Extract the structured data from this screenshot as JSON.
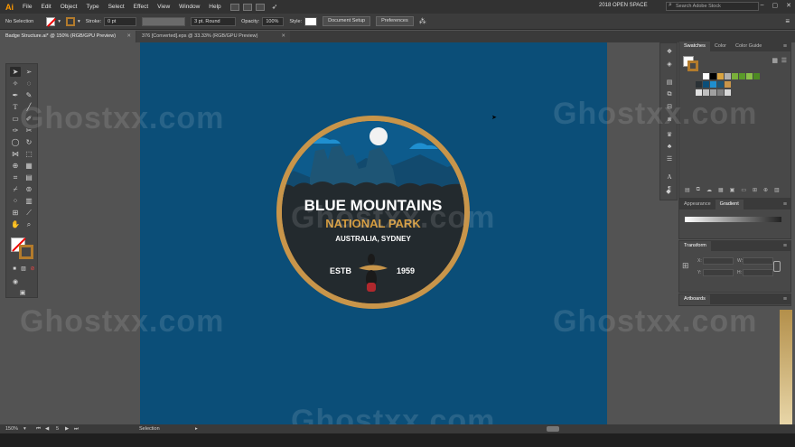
{
  "app": {
    "logo": "Ai",
    "menus": [
      "File",
      "Edit",
      "Object",
      "Type",
      "Select",
      "Effect",
      "View",
      "Window",
      "Help"
    ],
    "workspace": "2018 OPEN SPACE",
    "search_placeholder": "Search Adobe Stock"
  },
  "control": {
    "selection": "No Selection",
    "stroke_label": "Stroke:",
    "stroke_value": "0 pt",
    "brush": "3 pt. Round",
    "opacity_label": "Opacity:",
    "opacity_value": "100%",
    "style_label": "Style:",
    "doc_setup": "Document Setup",
    "preferences": "Preferences"
  },
  "tabs": [
    {
      "label": "Badge Structure.ai* @ 150% (RGB/GPU Preview)"
    },
    {
      "label": "376 [Converted].eps @ 33.33% (RGB/GPU Preview)"
    }
  ],
  "badge": {
    "line1": "BLUE MOUNTAINS",
    "line2": "NATIONAL PARK",
    "line3": "AUSTRALIA, SYDNEY",
    "estb": "ESTB",
    "year": "1959"
  },
  "panels": {
    "swatches_tabs": [
      "Swatches",
      "Color",
      "Color Guide"
    ],
    "appearance_tabs": [
      "Appearance",
      "Gradient"
    ],
    "transform_title": "Transform",
    "artboards_title": "Artboards",
    "transform_labels": [
      "X:",
      "Y:",
      "W:",
      "H:"
    ]
  },
  "status": {
    "zoom": "150%",
    "page": "5",
    "tool": "Selection"
  },
  "watermark": "Ghostxx.com",
  "colors": {
    "canvas": "#0b4e78",
    "badge_ring": "#c8954a",
    "badge_dark": "#2a3135",
    "gold_text": "#d39a3c"
  }
}
